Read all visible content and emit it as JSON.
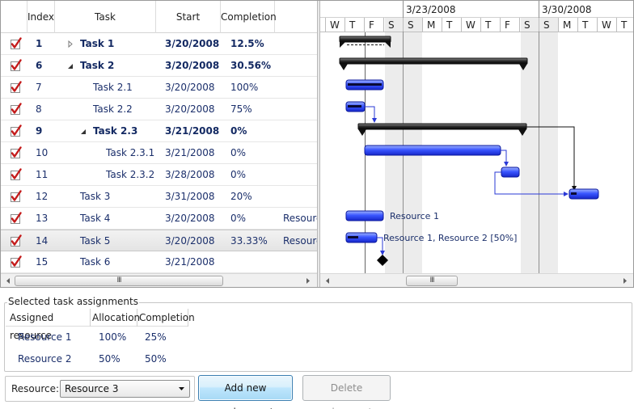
{
  "grid": {
    "columns": {
      "index": "Index",
      "task": "Task",
      "start": "Start",
      "completion": "Completion"
    },
    "rows": [
      {
        "index": "1",
        "task": "Task 1",
        "start": "3/20/2008",
        "completion": "12.5%",
        "resource": "",
        "bold": true,
        "level": 0,
        "expander": "collapsed"
      },
      {
        "index": "6",
        "task": "Task 2",
        "start": "3/20/2008",
        "completion": "30.56%",
        "resource": "",
        "bold": true,
        "level": 0,
        "expander": "expanded"
      },
      {
        "index": "7",
        "task": "Task 2.1",
        "start": "3/20/2008",
        "completion": "100%",
        "resource": "",
        "bold": false,
        "level": 1,
        "expander": ""
      },
      {
        "index": "8",
        "task": "Task 2.2",
        "start": "3/20/2008",
        "completion": "75%",
        "resource": "",
        "bold": false,
        "level": 1,
        "expander": ""
      },
      {
        "index": "9",
        "task": "Task 2.3",
        "start": "3/21/2008",
        "completion": "0%",
        "resource": "",
        "bold": true,
        "level": 1,
        "expander": "expanded"
      },
      {
        "index": "10",
        "task": "Task 2.3.1",
        "start": "3/21/2008",
        "completion": "0%",
        "resource": "",
        "bold": false,
        "level": 2,
        "expander": ""
      },
      {
        "index": "11",
        "task": "Task 2.3.2",
        "start": "3/28/2008",
        "completion": "0%",
        "resource": "",
        "bold": false,
        "level": 2,
        "expander": ""
      },
      {
        "index": "12",
        "task": "Task 3",
        "start": "3/31/2008",
        "completion": "20%",
        "resource": "",
        "bold": false,
        "level": 0,
        "expander": ""
      },
      {
        "index": "13",
        "task": "Task 4",
        "start": "3/20/2008",
        "completion": "0%",
        "resource": "Resourc",
        "bold": false,
        "level": 0,
        "expander": ""
      },
      {
        "index": "14",
        "task": "Task 5",
        "start": "3/20/2008",
        "completion": "33.33%",
        "resource": "Resourc",
        "bold": false,
        "level": 0,
        "expander": "",
        "selected": true
      },
      {
        "index": "15",
        "task": "Task 6",
        "start": "3/21/2008",
        "completion": "",
        "resource": "",
        "bold": false,
        "level": 0,
        "expander": ""
      }
    ]
  },
  "timeline": {
    "weeks": [
      "3/23/2008",
      "3/30/2008"
    ],
    "days": [
      "W",
      "T",
      "F",
      "S",
      "S",
      "M",
      "T",
      "W",
      "T",
      "F",
      "S",
      "S",
      "M",
      "T",
      "W",
      "T"
    ],
    "bar_labels": {
      "task4": "Resource 1",
      "task5": "Resource 1, Resource 2 [50%]"
    }
  },
  "assignments": {
    "legend": "Selected task assignments",
    "columns": {
      "resource": "Assigned resource",
      "allocation": "Allocation",
      "completion": "Completion"
    },
    "rows": [
      {
        "resource": "Resource 1",
        "allocation": "100%",
        "completion": "25%"
      },
      {
        "resource": "Resource 2",
        "allocation": "50%",
        "completion": "50%"
      }
    ]
  },
  "controls": {
    "resource_label": "Resource:",
    "resource_value": "Resource 3",
    "add_button": "Add new assignment",
    "delete_button": "Delete assignments"
  },
  "scroll_glyph": "III",
  "colors": {
    "bar_blue": "#2b45f0",
    "summary_black": "#1a1a1a",
    "weekend": "#ececec",
    "text_blue": "#1b2f6b"
  }
}
